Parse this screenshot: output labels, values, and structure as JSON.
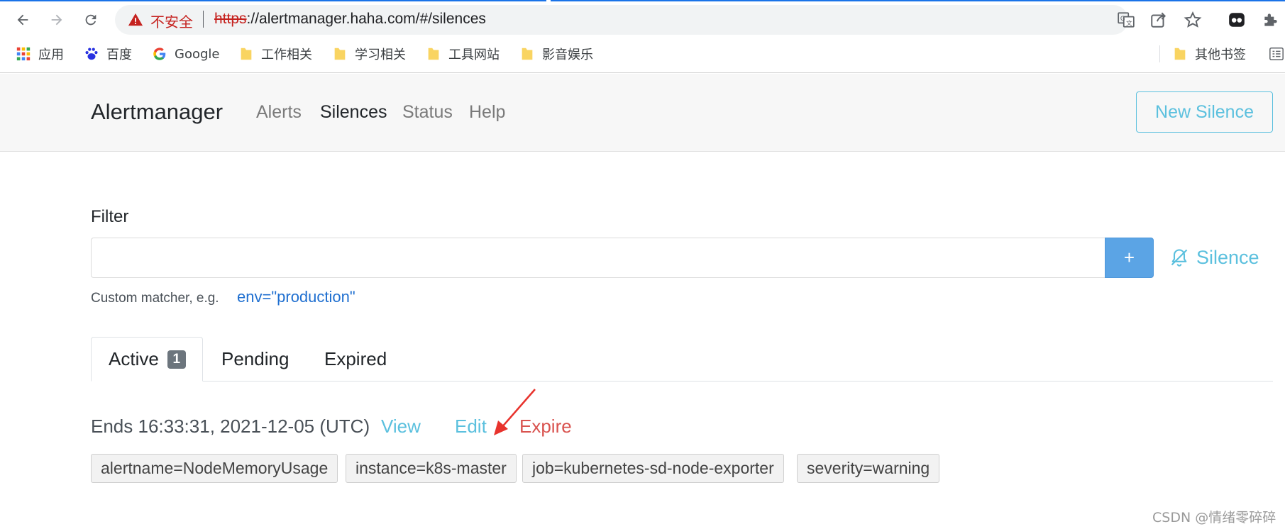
{
  "browser": {
    "security_label": "不安全",
    "url_scheme": "https",
    "url_rest": "://alertmanager.haha.com/#/silences",
    "icons": [
      "back-icon",
      "forward-icon",
      "reload-icon",
      "warning-icon",
      "translate-icon",
      "share-icon",
      "star-icon",
      "extension-icon",
      "puzzle-icon",
      "reading-list-icon"
    ],
    "bookmarks": [
      {
        "label": "应用",
        "icon": "apps-grid-icon"
      },
      {
        "label": "百度",
        "icon": "baidu-paw-icon"
      },
      {
        "label": "Google",
        "icon": "google-g-icon"
      },
      {
        "label": "工作相关",
        "icon": "folder-icon"
      },
      {
        "label": "学习相关",
        "icon": "folder-icon"
      },
      {
        "label": "工具网站",
        "icon": "folder-icon"
      },
      {
        "label": "影音娱乐",
        "icon": "folder-icon"
      }
    ],
    "other_bookmarks": "其他书签"
  },
  "app": {
    "brand": "Alertmanager",
    "nav": [
      "Alerts",
      "Silences",
      "Status",
      "Help"
    ],
    "active_nav": "Silences",
    "new_silence_label": "New Silence"
  },
  "filter": {
    "label": "Filter",
    "value": "",
    "add_label": "+",
    "silence_label": "Silence",
    "hint": "Custom matcher, e.g.",
    "hint_example": "env=\"production\""
  },
  "tabs": [
    {
      "label": "Active",
      "badge": "1"
    },
    {
      "label": "Pending"
    },
    {
      "label": "Expired"
    }
  ],
  "silence": {
    "ends": "Ends 16:33:31, 2021-12-05 (UTC)",
    "view_label": "View",
    "edit_label": "Edit",
    "expire_label": "Expire",
    "matchers": [
      "alertname=NodeMemoryUsage",
      "instance=k8s-master",
      "job=kubernetes-sd-node-exporter",
      "severity=warning"
    ]
  },
  "colors": {
    "info": "#5bc0de",
    "danger": "#d9534f",
    "primary_button": "#5ba4e5",
    "annotation_arrow": "#e8332d"
  },
  "watermark": "CSDN @情绪零碎碎"
}
